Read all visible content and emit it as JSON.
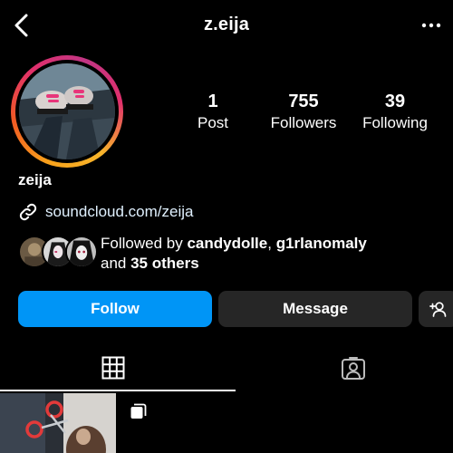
{
  "header": {
    "username": "z.eija",
    "back_icon": "chevron-left-icon",
    "more_icon": "more-horizontal-icon"
  },
  "profile": {
    "display_name": "zeija",
    "link": "soundcloud.com/zeija",
    "stats": [
      {
        "value": "1",
        "label": "Post"
      },
      {
        "value": "755",
        "label": "Followers"
      },
      {
        "value": "39",
        "label": "Following"
      }
    ],
    "followed_by": {
      "prefix": "Followed by ",
      "user1": "candydolle",
      "separator": ", ",
      "user2": "g1rlanomaly",
      "and": "and ",
      "others": "35 others"
    }
  },
  "actions": {
    "follow": "Follow",
    "message": "Message"
  },
  "colors": {
    "background": "#000000",
    "follow_button": "#0095f6",
    "secondary_button": "#262626",
    "link_text": "#e0f1ff"
  }
}
